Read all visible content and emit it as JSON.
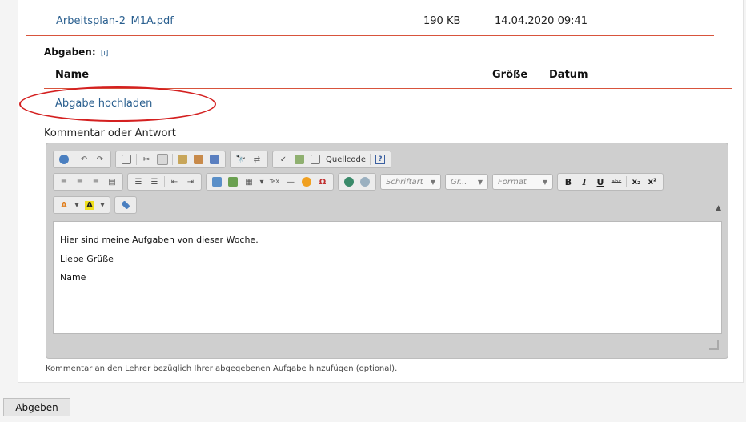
{
  "file": {
    "name": "Arbeitsplan-2_M1A.pdf",
    "size": "190 KB",
    "date": "14.04.2020 09:41"
  },
  "abgaben": {
    "heading": "Abgaben:",
    "info": "[i]"
  },
  "table": {
    "col_name": "Name",
    "col_size": "Größe",
    "col_date": "Datum"
  },
  "upload_link": "Abgabe hochladen",
  "comment": {
    "label": "Kommentar oder Antwort",
    "toolbar": {
      "source_label": "Quellcode",
      "help_label": "?",
      "font_placeholder": "Schriftart",
      "size_placeholder": "Gr...",
      "format_placeholder": "Format",
      "bold": "B",
      "italic": "I",
      "underline": "U",
      "strike": "abc",
      "subscript": "x₂",
      "superscript": "x²",
      "tex": "TeX"
    },
    "content_lines": [
      "Hier sind meine Aufgaben von dieser Woche.",
      "Liebe Grüße",
      "Name"
    ],
    "hint": "Kommentar an den Lehrer bezüglich Ihrer abgegebenen Aufgabe hinzufügen (optional)."
  },
  "submit_label": "Abgeben",
  "colors": {
    "accent_line": "#d8543c",
    "link": "#2a5f8f",
    "highlight": "#d42020"
  }
}
